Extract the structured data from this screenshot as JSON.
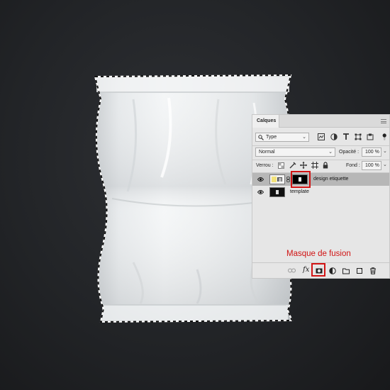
{
  "panel": {
    "tab_label": "Calques",
    "filter_value": "Type",
    "blend_mode": "Normal",
    "opacity_label": "Opacité :",
    "opacity_value": "100 %",
    "lock_label": "Verrou :",
    "fill_label": "Fond :",
    "fill_value": "100 %",
    "layers": [
      {
        "name": "design etiquette",
        "selected": true,
        "visible": true
      },
      {
        "name": "template",
        "selected": false,
        "visible": true
      }
    ],
    "bottom_fx_label": "fx"
  },
  "callout": {
    "text": "Masque de fusion"
  },
  "icons": {
    "filter": "search-icon",
    "panel_menu": "hamburger-icon",
    "link": "link-icon",
    "mask": "add-mask-icon",
    "adjustment": "adjustment-layer-icon",
    "group": "folder-icon",
    "new_layer": "new-layer-icon",
    "delete": "trash-icon"
  },
  "colors": {
    "highlight": "#d21414",
    "selected_row": "#b7b7b7"
  }
}
